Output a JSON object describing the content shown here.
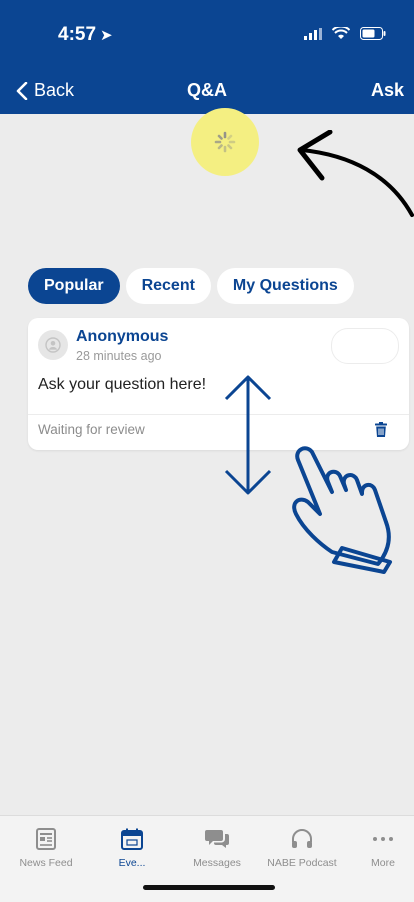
{
  "status_bar": {
    "time": "4:57",
    "location_glyph": "➤"
  },
  "nav": {
    "back_label": "Back",
    "title": "Q&A",
    "ask_label": "Ask"
  },
  "tabs": [
    {
      "label": "Popular",
      "active": true
    },
    {
      "label": "Recent",
      "active": false
    },
    {
      "label": "My Questions",
      "active": false
    }
  ],
  "question_card": {
    "author": "Anonymous",
    "time": "28 minutes ago",
    "question": "Ask your question here!",
    "status": "Waiting for review"
  },
  "tabbar": [
    {
      "label": "News Feed",
      "icon": "news-feed-icon"
    },
    {
      "label": "Eve...",
      "icon": "calendar-icon",
      "active": true
    },
    {
      "label": "Messages",
      "icon": "messages-icon"
    },
    {
      "label": "NABE Podcast",
      "icon": "headphones-icon"
    },
    {
      "label": "More",
      "icon": "more-icon"
    }
  ],
  "colors": {
    "brand": "#0b4592",
    "highlight": "#f4ef82",
    "background": "#ececec"
  }
}
